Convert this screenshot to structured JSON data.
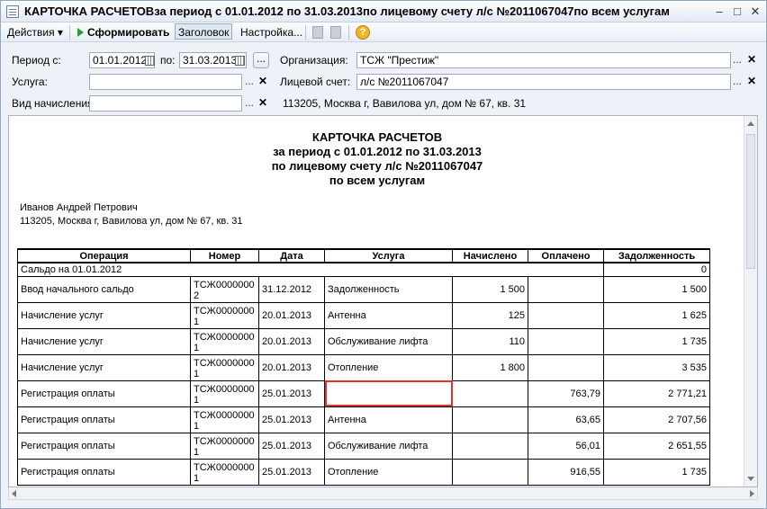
{
  "window": {
    "title": "КАРТОЧКА РАСЧЕТОВза период с 01.01.2012 по 31.03.2013по лицевому счету л/с №2011067047по всем услугам",
    "buttons": {
      "minimize": "–",
      "maximize": "□",
      "close": "✕"
    }
  },
  "toolbar": {
    "actions_label": "Действия",
    "actions_arrow": "▾",
    "generate_label": "Сформировать",
    "header_label": "Заголовок",
    "settings_label": "Настройка...",
    "help_label": "?"
  },
  "form": {
    "period_label": "Период с:",
    "period_from": "01.01.2012",
    "period_to_label": "по:",
    "period_to": "31.03.2013",
    "ellipsis": "...",
    "org_label": "Организация:",
    "org_value": "ТСЖ \"Престиж\"",
    "service_label": "Услуга:",
    "service_value": "",
    "account_label": "Лицевой счет:",
    "account_value": "л/с №2011067047",
    "accrual_label": "Вид начисления",
    "accrual_value": "",
    "address_info": "113205, Москва г, Вавилова ул, дом № 67, кв. 31",
    "clear_glyph": "✕"
  },
  "report": {
    "title_lines": [
      "КАРТОЧКА РАСЧЕТОВ",
      "за период с 01.01.2012 по 31.03.2013",
      "по лицевому счету л/с №2011067047",
      "по всем услугам"
    ],
    "owner_name": "Иванов Андрей Петрович",
    "owner_address": "113205, Москва г, Вавилова ул, дом № 67, кв. 31",
    "columns": [
      "Операция",
      "Номер",
      "Дата",
      "Услуга",
      "Начислено",
      "Оплачено",
      "Задолженность"
    ],
    "saldo": {
      "label": "Сальдо на 01.01.2012",
      "debt": "0"
    },
    "rows": [
      {
        "operation": "Ввод начального сальдо",
        "number": "ТСЖ00000002",
        "date": "31.12.2012",
        "service": "Задолженность",
        "accrued": "1 500",
        "paid": "",
        "debt": "1 500"
      },
      {
        "operation": "Начисление услуг",
        "number": "ТСЖ00000001",
        "date": "20.01.2013",
        "service": "Антенна",
        "accrued": "125",
        "paid": "",
        "debt": "1 625"
      },
      {
        "operation": "Начисление услуг",
        "number": "ТСЖ00000001",
        "date": "20.01.2013",
        "service": "Обслуживание лифта",
        "accrued": "110",
        "paid": "",
        "debt": "1 735"
      },
      {
        "operation": "Начисление услуг",
        "number": "ТСЖ00000001",
        "date": "20.01.2013",
        "service": "Отопление",
        "accrued": "1 800",
        "paid": "",
        "debt": "3 535"
      },
      {
        "operation": "Регистрация оплаты",
        "number": "ТСЖ00000001",
        "date": "25.01.2013",
        "service": "",
        "accrued": "",
        "paid": "763,79",
        "debt": "2 771,21",
        "selected": true
      },
      {
        "operation": "Регистрация оплаты",
        "number": "ТСЖ00000001",
        "date": "25.01.2013",
        "service": "Антенна",
        "accrued": "",
        "paid": "63,65",
        "debt": "2 707,56"
      },
      {
        "operation": "Регистрация оплаты",
        "number": "ТСЖ00000001",
        "date": "25.01.2013",
        "service": "Обслуживание лифта",
        "accrued": "",
        "paid": "56,01",
        "debt": "2 651,55"
      },
      {
        "operation": "Регистрация оплаты",
        "number": "ТСЖ00000001",
        "date": "25.01.2013",
        "service": "Отопление",
        "accrued": "",
        "paid": "916,55",
        "debt": "1 735"
      }
    ]
  }
}
